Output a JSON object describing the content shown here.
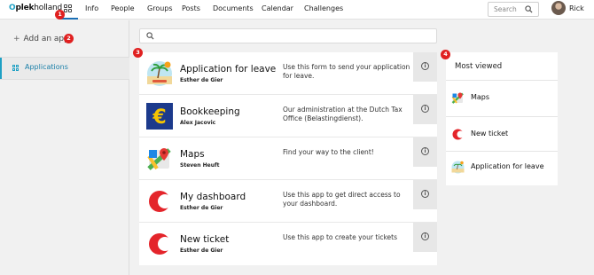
{
  "header": {
    "logo_mark": "O",
    "logo_bold": "plek",
    "logo_rest": "holland",
    "nav": [
      "Info",
      "People",
      "Groups",
      "Posts",
      "Documents",
      "Calendar",
      "Challenges"
    ],
    "search_placeholder": "Search",
    "user_name": "Rick"
  },
  "annotations": [
    "1",
    "2",
    "3",
    "4"
  ],
  "sidebar": {
    "add_app_label": "Add an app",
    "add_icon": "plus-icon",
    "items": [
      {
        "label": "Applications",
        "icon": "grid-icon"
      }
    ]
  },
  "main": {
    "search_placeholder": "",
    "apps": [
      {
        "title": "Application for leave",
        "owner": "Esther de Gier",
        "description": "Use this form to send your application for leave.",
        "icon": "beach-icon"
      },
      {
        "title": "Bookkeeping",
        "owner": "Alex Jacovic",
        "description": "Our administration at the Dutch Tax Office (Belastingdienst).",
        "icon": "euro-icon"
      },
      {
        "title": "Maps",
        "owner": "Steven Heuft",
        "description": "Find your way to the client!",
        "icon": "maps-icon"
      },
      {
        "title": "My dashboard",
        "owner": "Esther de Gier",
        "description": "Use this app to get direct access to your dashboard.",
        "icon": "crescent-icon"
      },
      {
        "title": "New ticket",
        "owner": "Esther de Gier",
        "description": "Use this app to create your tickets",
        "icon": "crescent-icon"
      }
    ]
  },
  "most_viewed": {
    "title": "Most viewed",
    "items": [
      {
        "label": "Maps",
        "icon": "maps-icon"
      },
      {
        "label": "New ticket",
        "icon": "crescent-icon"
      },
      {
        "label": "Application for leave",
        "icon": "beach-icon"
      }
    ]
  },
  "colors": {
    "accent": "#1ea0c4",
    "annotation": "#e02020",
    "brand_red": "#e4252b",
    "euro_bg": "#1c3a8c",
    "euro_fg": "#f5c400"
  }
}
